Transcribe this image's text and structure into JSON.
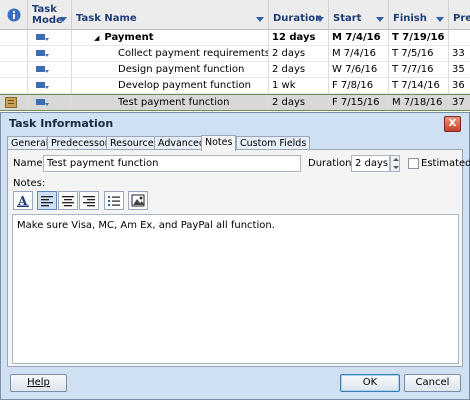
{
  "gantt": {
    "columns": {
      "info": "i",
      "task_mode": "Task Mode",
      "task_name": "Task Name",
      "duration": "Duration",
      "start": "Start",
      "finish": "Finish",
      "predecessors": "Pre"
    },
    "rows": [
      {
        "name": "Payment",
        "duration": "12 days",
        "start": "M 7/4/16",
        "finish": "T 7/19/16",
        "pred": "",
        "summary": true
      },
      {
        "name": "Collect payment requirements",
        "duration": "2 days",
        "start": "M 7/4/16",
        "finish": "T 7/5/16",
        "pred": "33",
        "summary": false
      },
      {
        "name": "Design payment function",
        "duration": "2 days",
        "start": "W 7/6/16",
        "finish": "T 7/7/16",
        "pred": "35",
        "summary": false
      },
      {
        "name": "Develop payment function",
        "duration": "1 wk",
        "start": "F 7/8/16",
        "finish": "T 7/14/16",
        "pred": "36",
        "summary": false
      },
      {
        "name": "Test payment function",
        "duration": "2 days",
        "start": "F 7/15/16",
        "finish": "M 7/18/16",
        "pred": "37",
        "summary": false,
        "selected": true
      }
    ]
  },
  "dialog": {
    "title": "Task Information",
    "close_glyph": "X",
    "tabs": [
      {
        "label": "General"
      },
      {
        "label": "Predecessors"
      },
      {
        "label": "Resources"
      },
      {
        "label": "Advanced"
      },
      {
        "label": "Notes",
        "active": true
      },
      {
        "label": "Custom Fields"
      }
    ],
    "name_label": "Name:",
    "name_value": "Test payment function",
    "duration_label": "Duration:",
    "duration_value": "2 days",
    "estimated_label": "Estimated",
    "estimated_checked": false,
    "notes_label": "Notes:",
    "toolbar": [
      "font-icon",
      "align-left-icon",
      "align-center-icon",
      "align-right-icon",
      "bullet-list-icon",
      "insert-object-icon"
    ],
    "notes_text": "Make sure Visa, MC, Am Ex, and PayPal all function.",
    "help_label": "Help",
    "ok_label": "OK",
    "cancel_label": "Cancel"
  },
  "colors": {
    "header_text": "#1f3d78",
    "dialog_bg": "#cfe0f3",
    "selected_row": "#d8d8d8"
  }
}
